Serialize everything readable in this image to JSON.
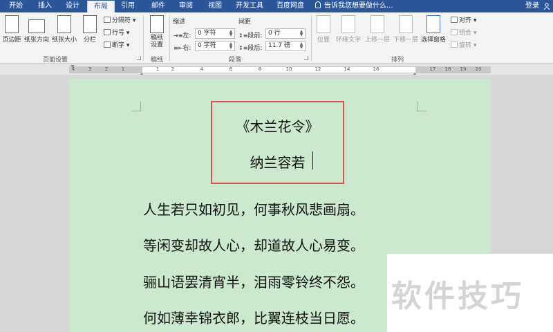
{
  "tabs": [
    "开始",
    "插入",
    "设计",
    "布局",
    "引用",
    "邮件",
    "审阅",
    "视图",
    "开发工具",
    "百度网盘"
  ],
  "tell_me": "告诉我您想要做什么...",
  "login": "登录",
  "ribbon": {
    "page_setup": {
      "margins": "页边距",
      "orientation": "纸张方向",
      "size": "纸张大小",
      "columns": "分栏",
      "breaks": "分隔符",
      "line_numbers": "行号",
      "hyphenation": "断字",
      "label": "页面设置"
    },
    "draft": {
      "button": "稿纸\n设置",
      "label": "稿纸"
    },
    "paragraph": {
      "indent_header": "缩进",
      "spacing_header": "间距",
      "left_label": "左:",
      "right_label": "右:",
      "left_value": "0 字符",
      "right_value": "0 字符",
      "before_label": "段前:",
      "after_label": "段后:",
      "before_value": "0 行",
      "after_value": "11.7 磅",
      "label": "段落"
    },
    "arrange": {
      "position": "位置",
      "wrap_text": "环绕文字",
      "bring_forward": "上移一层",
      "send_backward": "下移一层",
      "selection_pane": "选择窗格",
      "align": "对齐",
      "group": "组合",
      "rotate": "旋转",
      "label": "排列"
    }
  },
  "ruler_numbers": [
    "4",
    "3",
    "2",
    "1",
    "1",
    "2",
    "4",
    "6",
    "8",
    "10",
    "12",
    "14",
    "16",
    "17",
    "18",
    "19",
    "20"
  ],
  "document": {
    "title": "《木兰花令》",
    "author": "纳兰容若",
    "lines": [
      "人生若只如初见，何事秋风悲画扇。",
      "等闲变却故人心，却道故人心易变。",
      "骊山语罢清宵半，泪雨零铃终不怨。",
      "何如薄幸锦衣郎，比翼连枝当日愿。"
    ]
  },
  "watermark": "软件技巧",
  "colors": {
    "tab_bar": "#2b579a",
    "page": "#cce8cf",
    "highlight_box": "#d9534f"
  }
}
